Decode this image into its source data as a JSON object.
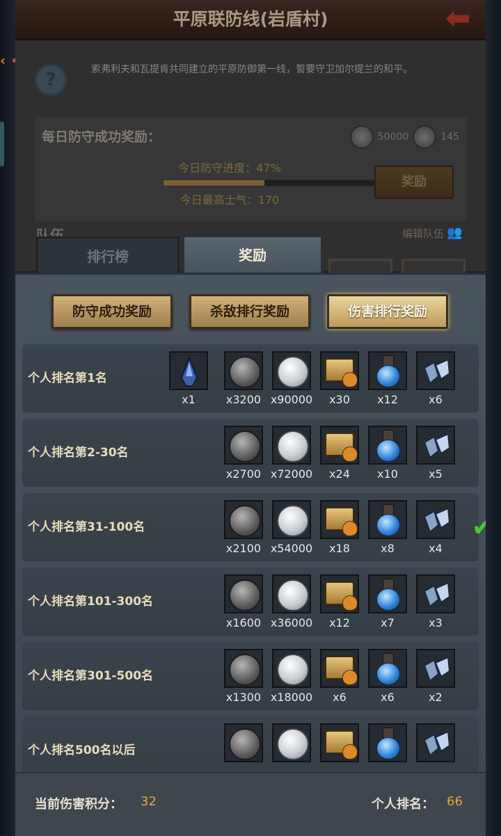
{
  "header": {
    "title": "平原联防线(岩盾村)"
  },
  "description": "索弗利夫和瓦提肯共同建立的平原防御第一线，誓要守卫加尔提兰的和平。",
  "daily": {
    "label": "每日防守成功奖励：",
    "reward_1": "50000",
    "reward_2": "145",
    "progress_text": "今日防守进度：47%",
    "progress": 0.47,
    "morale_text": "今日最高士气：170",
    "claim_button": "奖励"
  },
  "team": {
    "label": "队伍",
    "edit": "编辑队伍"
  },
  "tabs": {
    "rank": "排行榜",
    "reward": "奖励"
  },
  "categories": [
    "防守成功奖励",
    "杀敌排行奖励",
    "伤害排行奖励"
  ],
  "selected_category": 2,
  "rows": [
    {
      "label": "个人排名第1名",
      "ship": "x1",
      "q": [
        "x3200",
        "x90000",
        "x30",
        "x12",
        "x6"
      ]
    },
    {
      "label": "个人排名第2-30名",
      "q": [
        "x2700",
        "x72000",
        "x24",
        "x10",
        "x5"
      ]
    },
    {
      "label": "个人排名第31-100名",
      "q": [
        "x2100",
        "x54000",
        "x18",
        "x8",
        "x4"
      ],
      "claimed": true
    },
    {
      "label": "个人排名第101-300名",
      "q": [
        "x1600",
        "x36000",
        "x12",
        "x7",
        "x3"
      ]
    },
    {
      "label": "个人排名第301-500名",
      "q": [
        "x1300",
        "x18000",
        "x6",
        "x6",
        "x2"
      ]
    },
    {
      "label": "个人排名500名以后",
      "q": [
        "",
        "",
        "",
        "",
        ""
      ]
    }
  ],
  "footer": {
    "score_label": "当前伤害积分：",
    "score_value": "32",
    "rank_label": "个人排名：",
    "rank_value": "66"
  },
  "colors": {
    "accent": "#e3a73c",
    "check": "#48c838",
    "tab_active": "#47515a"
  }
}
